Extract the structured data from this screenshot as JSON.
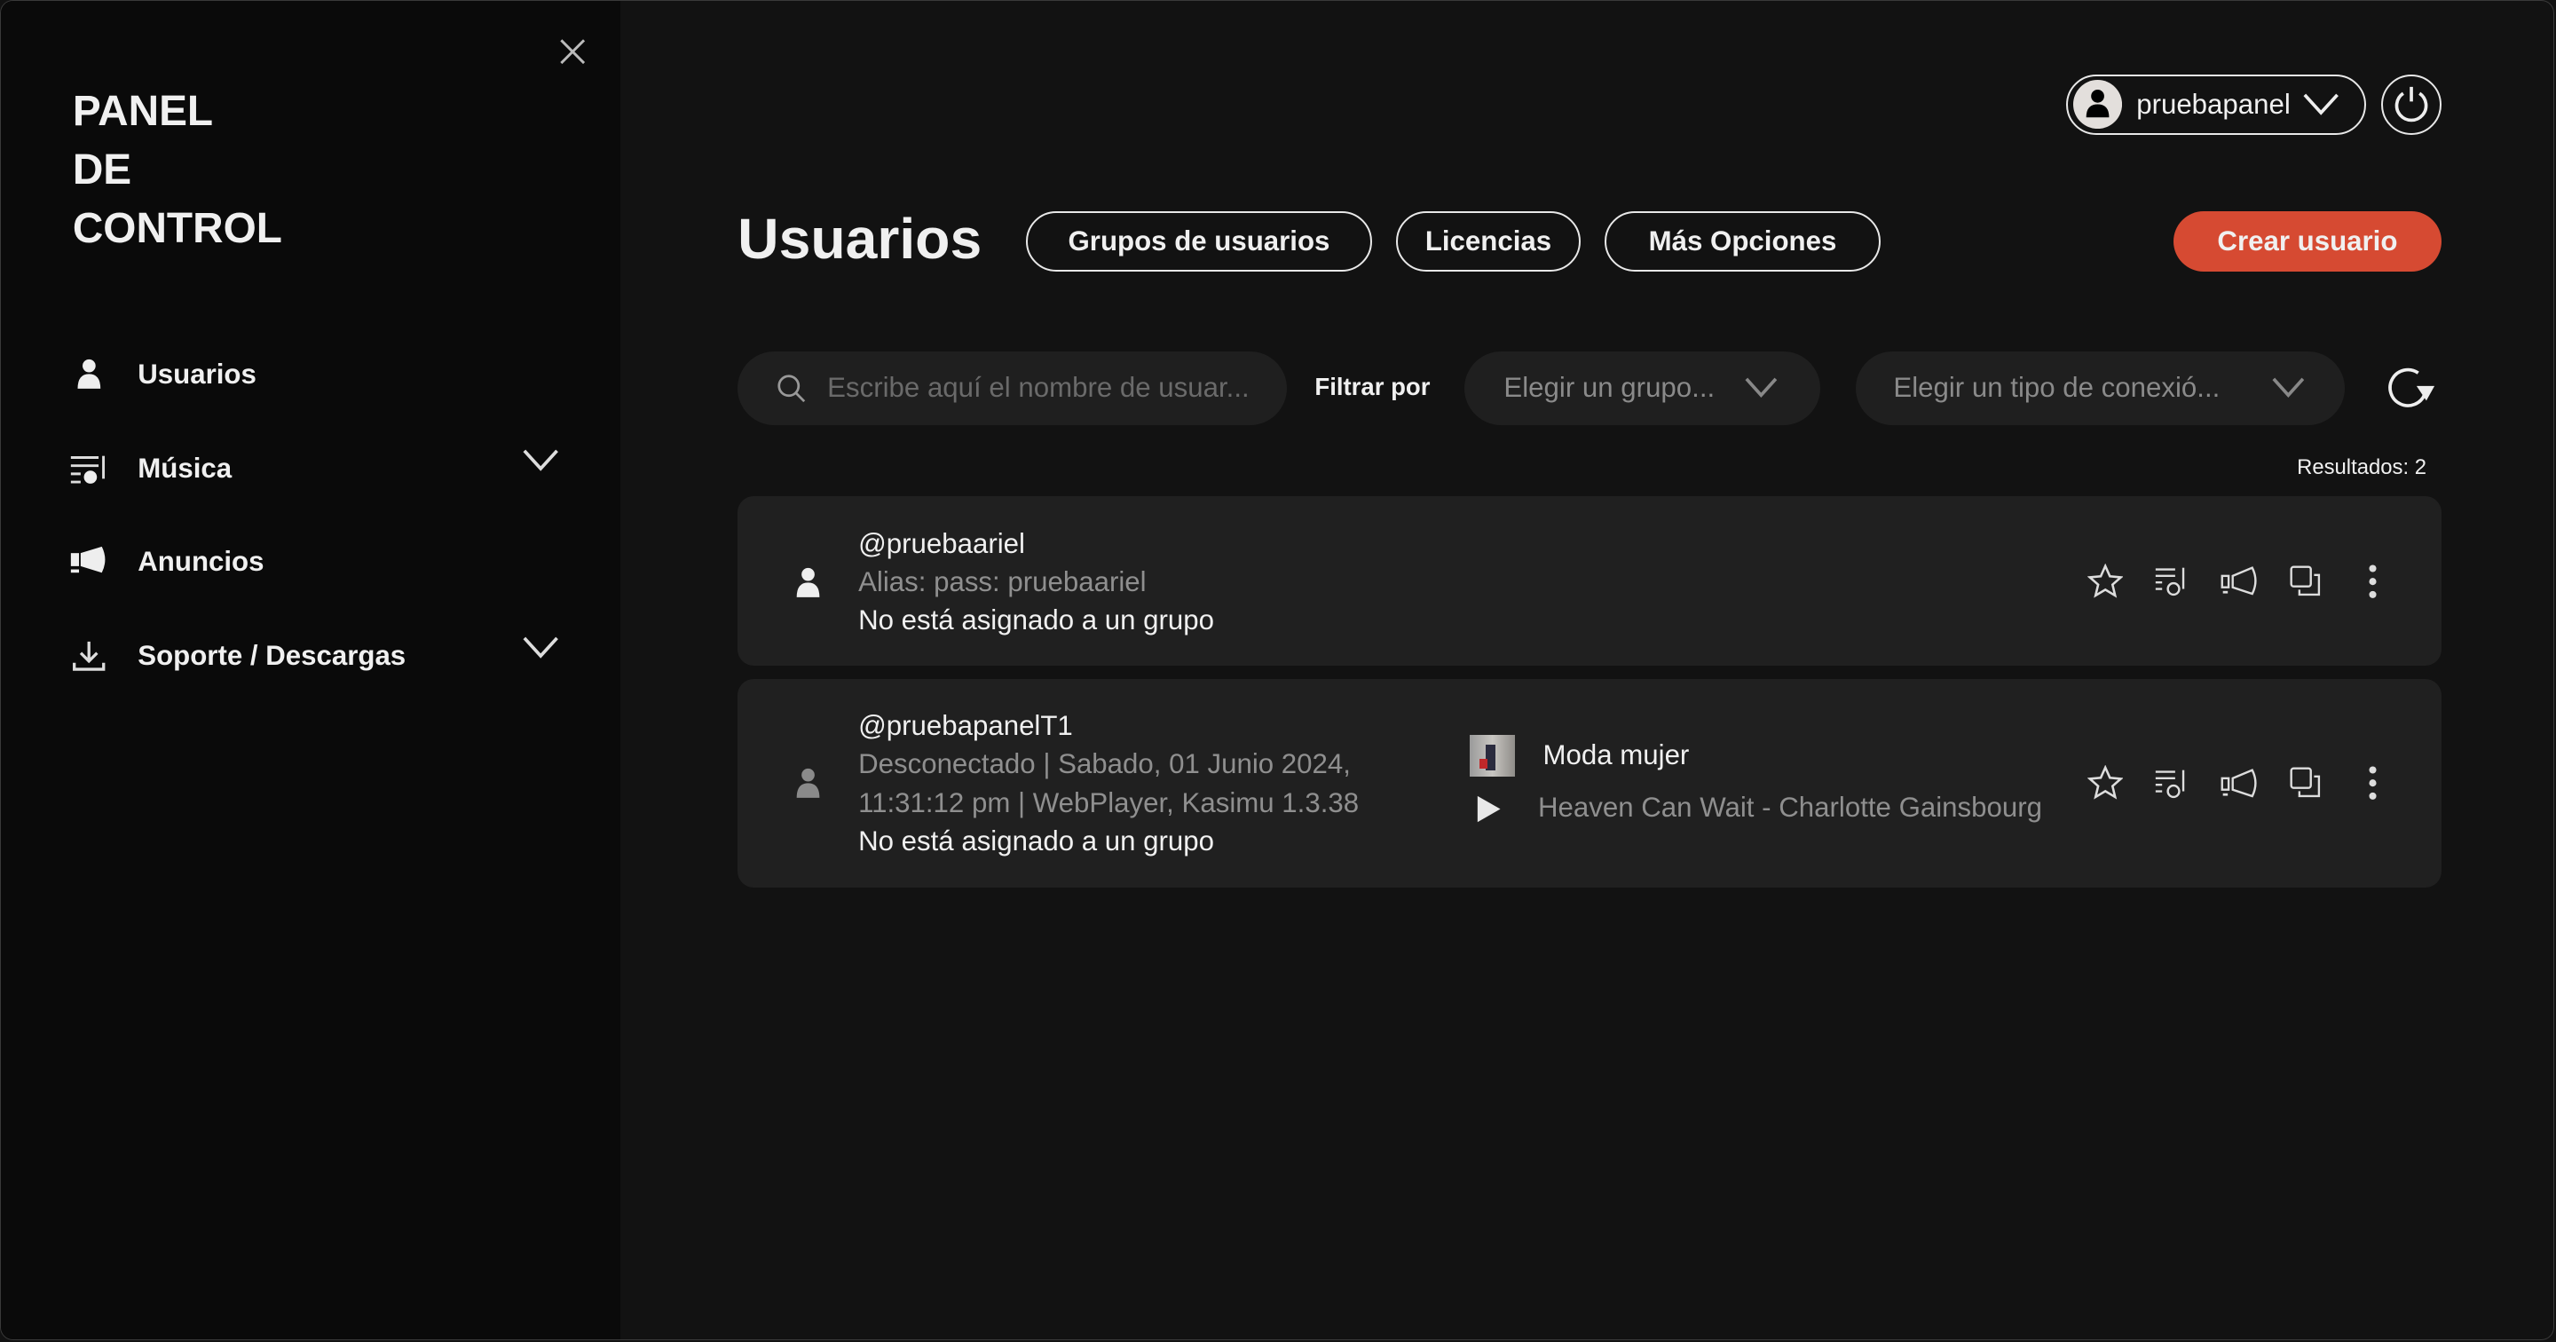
{
  "sidebar": {
    "brand": "PANEL\nDE\nCONTROL",
    "items": [
      {
        "label": "Usuarios",
        "icon": "user-icon"
      },
      {
        "label": "Música",
        "icon": "playlist-icon"
      },
      {
        "label": "Anuncios",
        "icon": "megaphone-icon"
      },
      {
        "label": "Soporte / Descargas",
        "icon": "download-icon"
      }
    ]
  },
  "header": {
    "username": "pruebapanel"
  },
  "page": {
    "title": "Usuarios",
    "tabs": [
      "Grupos de usuarios",
      "Licencias",
      "Más Opciones"
    ],
    "create_label": "Crear usuario"
  },
  "filters": {
    "search_placeholder": "Escribe aquí el nombre de usuar...",
    "filter_label": "Filtrar por",
    "group_placeholder": "Elegir un grupo...",
    "connection_placeholder": "Elegir un tipo de conexió...",
    "results": "Resultados: 2"
  },
  "users": [
    {
      "handle": "@pruebaariel",
      "detail": "Alias: pass: pruebaariel",
      "group": "No está asignado a un grupo"
    },
    {
      "handle": "@pruebapanelT1",
      "detail": "Desconectado | Sabado, 01 Junio 2024,",
      "detail2": "11:31:12 pm | WebPlayer, Kasimu 1.3.38",
      "group": "No está asignado a un grupo",
      "playlist": "Moda mujer",
      "track": "Heaven Can Wait - Charlotte Gainsbourg"
    }
  ],
  "colors": {
    "accent": "#d64a32",
    "sidebar": "#0a0a0a",
    "main": "#121212",
    "card": "#202020"
  }
}
